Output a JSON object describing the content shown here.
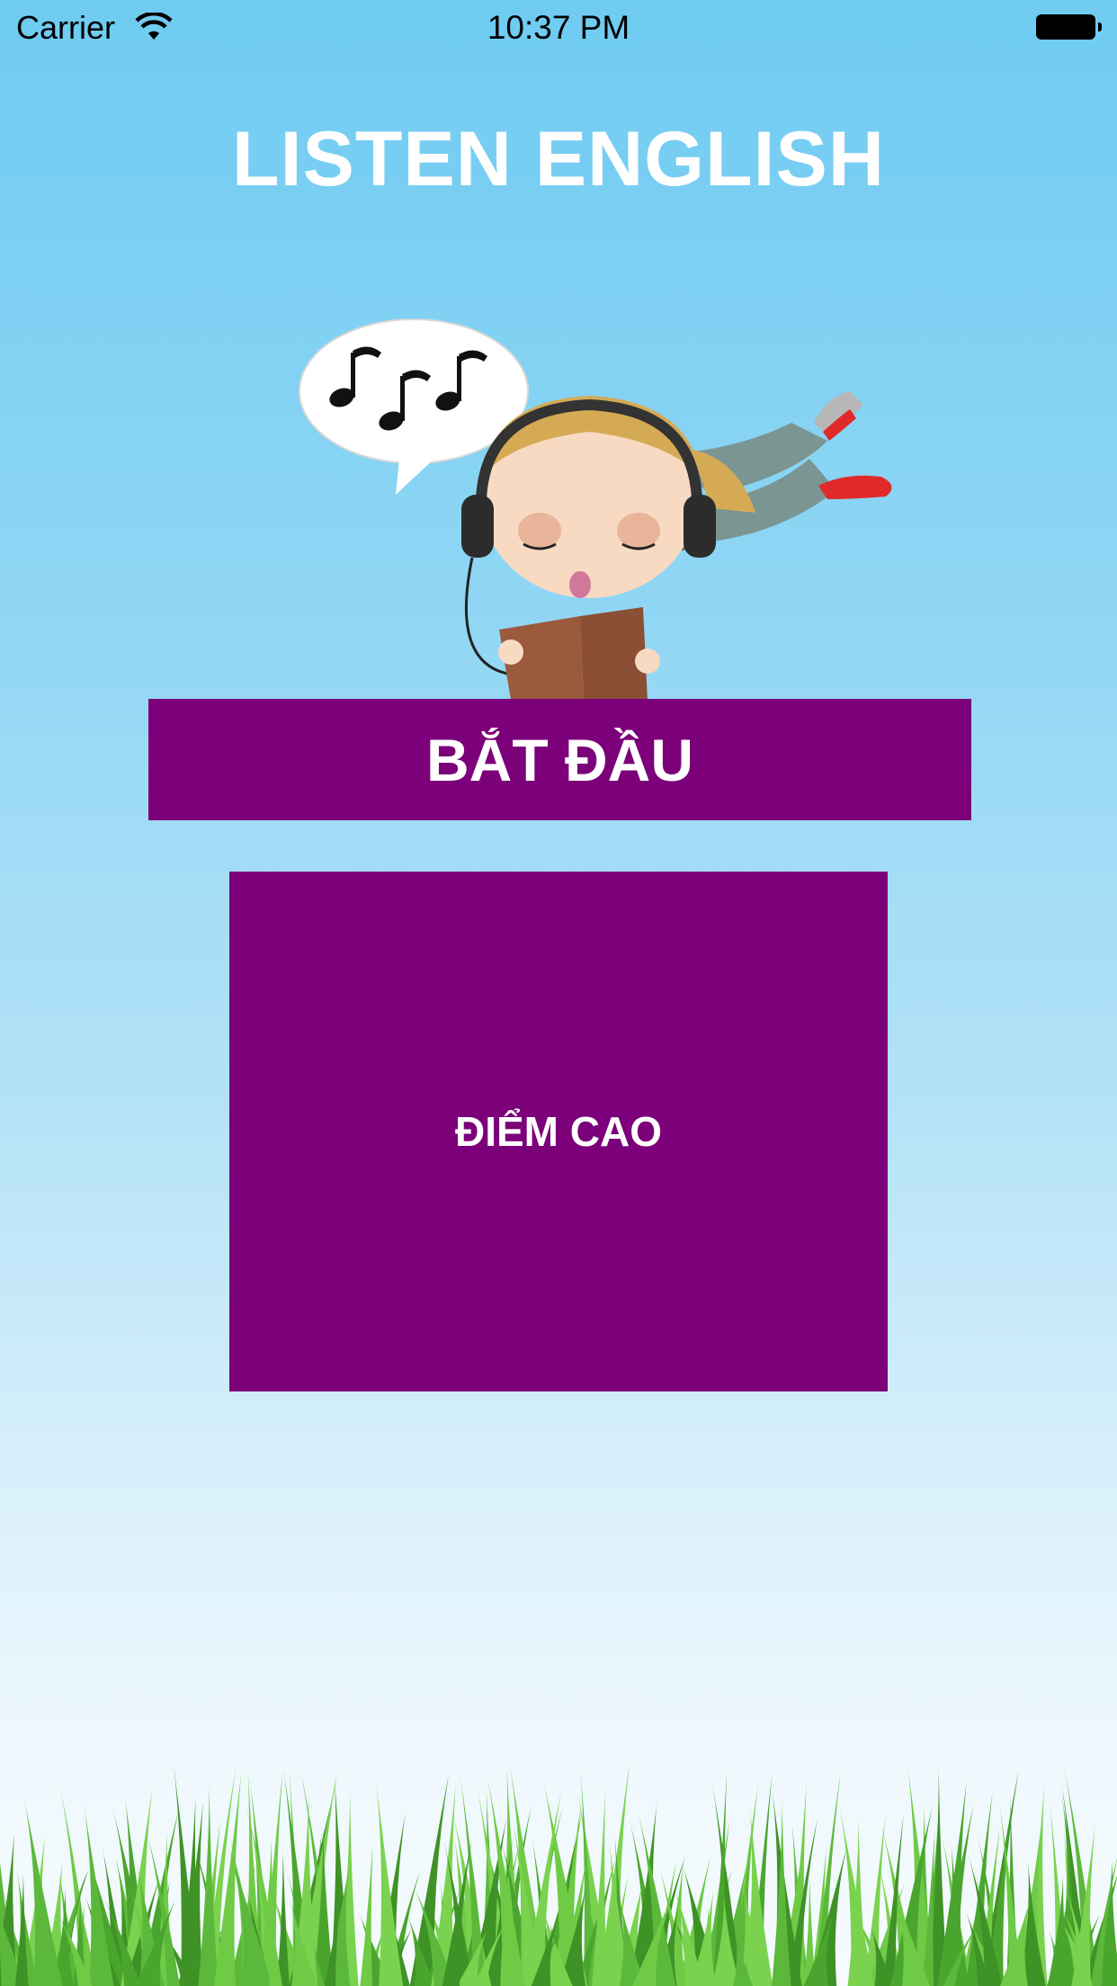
{
  "status_bar": {
    "carrier": "Carrier",
    "time": "10:37 PM",
    "icons": [
      "wifi-icon",
      "battery-icon"
    ]
  },
  "app": {
    "title": "LISTEN ENGLISH"
  },
  "buttons": {
    "start_label": "BẮT ĐẦU",
    "highscore_label": "ĐIỂM CAO"
  },
  "colors": {
    "sky_top": "#6fcbf1",
    "sky_bottom": "#f6fbfe",
    "button_purple": "#7b0079",
    "title_text": "#ffffff",
    "grass": "#5cb83a"
  },
  "images": {
    "illustration": "child-listening-with-headphones-reading-book",
    "footer": "grass"
  }
}
